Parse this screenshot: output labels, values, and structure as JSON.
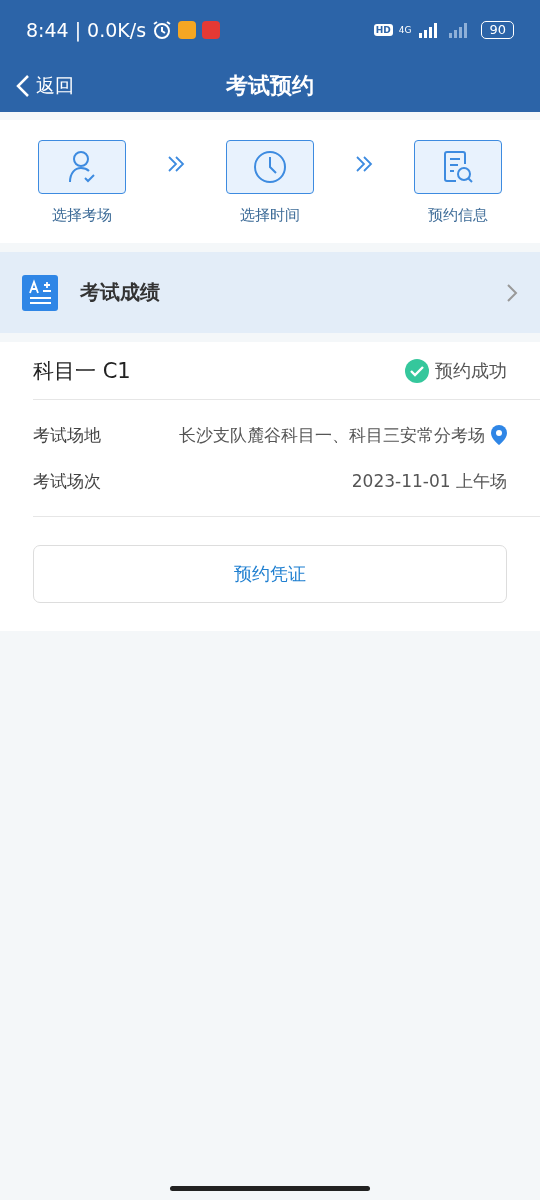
{
  "status_bar": {
    "time": "8:44",
    "separator": "|",
    "speed": "0.0K/s",
    "hd": "HD",
    "network": "4G",
    "battery": "90"
  },
  "nav": {
    "back": "返回",
    "title": "考试预约"
  },
  "steps": [
    {
      "kind": "person",
      "label": "选择考场"
    },
    {
      "kind": "clock",
      "label": "选择时间"
    },
    {
      "kind": "document",
      "label": "预约信息"
    }
  ],
  "score_row": {
    "label": "考试成绩"
  },
  "booking": {
    "subject": "科目一 C1",
    "status": "预约成功",
    "fields": [
      {
        "label": "考试场地",
        "value": "长沙支队麓谷科目一、科目三安常分考场",
        "kind": "location"
      },
      {
        "label": "考试场次",
        "value": "2023-11-01 上午场",
        "kind": "text"
      }
    ],
    "button": "预约凭证"
  }
}
